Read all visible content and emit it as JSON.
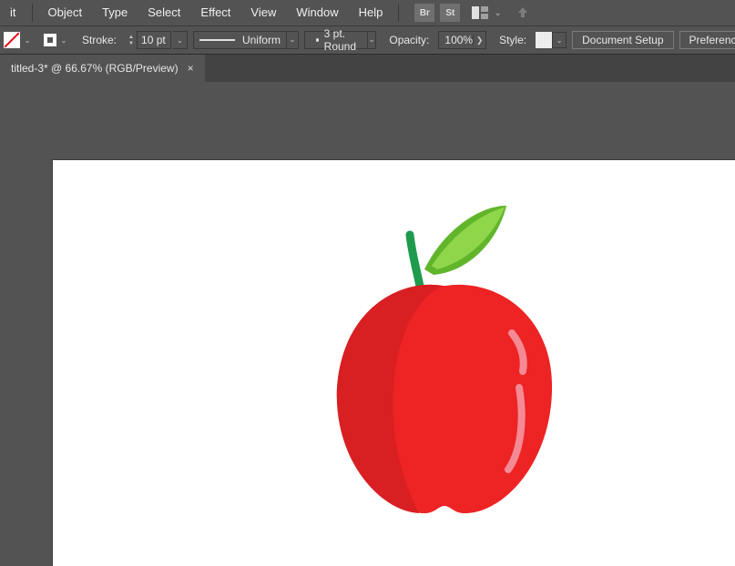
{
  "menubar": {
    "items": [
      "it",
      "Object",
      "Type",
      "Select",
      "Effect",
      "View",
      "Window",
      "Help"
    ],
    "bridge_label": "Br",
    "stock_label": "St"
  },
  "optbar": {
    "stroke_label": "Stroke:",
    "stroke_value": "10 pt",
    "profile_label": "Uniform",
    "brush_label": "3 pt. Round",
    "opacity_label": "Opacity:",
    "opacity_value": "100%",
    "style_label": "Style:",
    "doc_setup": "Document Setup",
    "preferences": "Preferences"
  },
  "tab": {
    "title": "titled-3* @ 66.67% (RGB/Preview)"
  }
}
